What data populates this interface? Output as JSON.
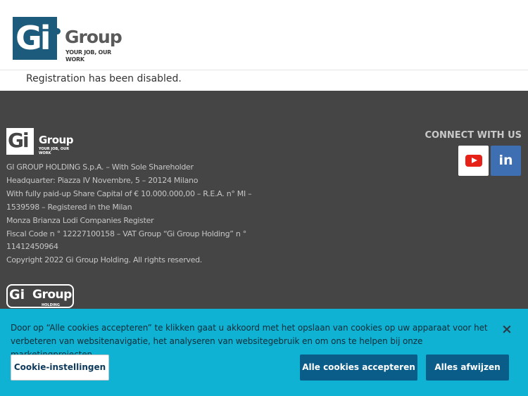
{
  "header": {
    "logo": {
      "mark_text": "Gi",
      "word": "Group",
      "tagline": "YOUR JOB, OUR WORK"
    }
  },
  "notice": "Registration has been disabled.",
  "footer": {
    "logo": {
      "mark_text": "Gi",
      "word": "Group",
      "tagline": "YOUR JOB, OUR WORK"
    },
    "legal_lines": [
      "GI GROUP HOLDING S.p.A. – With Sole Shareholder",
      "Headquarter: Piazza IV Novembre, 5 – 20124 Milano",
      "With fully paid-up Share Capital of € 10.000.000,00 – R.E.A. n° MI –",
      "1539598 – Registered in the Milan",
      "Monza Brianza Lodi Companies Register",
      "Fiscal Code n ° 12227100158 – VAT Group “Gi Group Holding” n °",
      "11412450964",
      "Copyright 2022 Gi Group Holding. All rights reserved."
    ],
    "connect_title": "CONNECT WITH US",
    "social": [
      {
        "name": "youtube",
        "icon": "youtube-icon"
      },
      {
        "name": "linkedin",
        "icon": "linkedin-icon",
        "glyph": "in"
      }
    ],
    "holding_logo": {
      "mark_text": "Gi",
      "word": "Group",
      "tagline": "HOLDING"
    }
  },
  "cookie_banner": {
    "message": "Door op “Alle cookies accepteren” te klikken gaat u akkoord met het opslaan van cookies op uw apparaat voor het verbeteren van websitenavigatie, het analyseren van websitegebruik en om ons te helpen bij onze marketingprojecten.",
    "close_glyph": "×",
    "settings_label": "Cookie-instellingen",
    "accept_label": "Alle cookies accepteren",
    "reject_label": "Alles afwijzen"
  },
  "colors": {
    "brand_blue": "#1d5b7c",
    "footer_bg": "#454545",
    "cookie_bg": "#0fb2d3",
    "cookie_button": "#0a5c89",
    "linkedin": "#3e6fb3",
    "youtube": "#e62117"
  }
}
